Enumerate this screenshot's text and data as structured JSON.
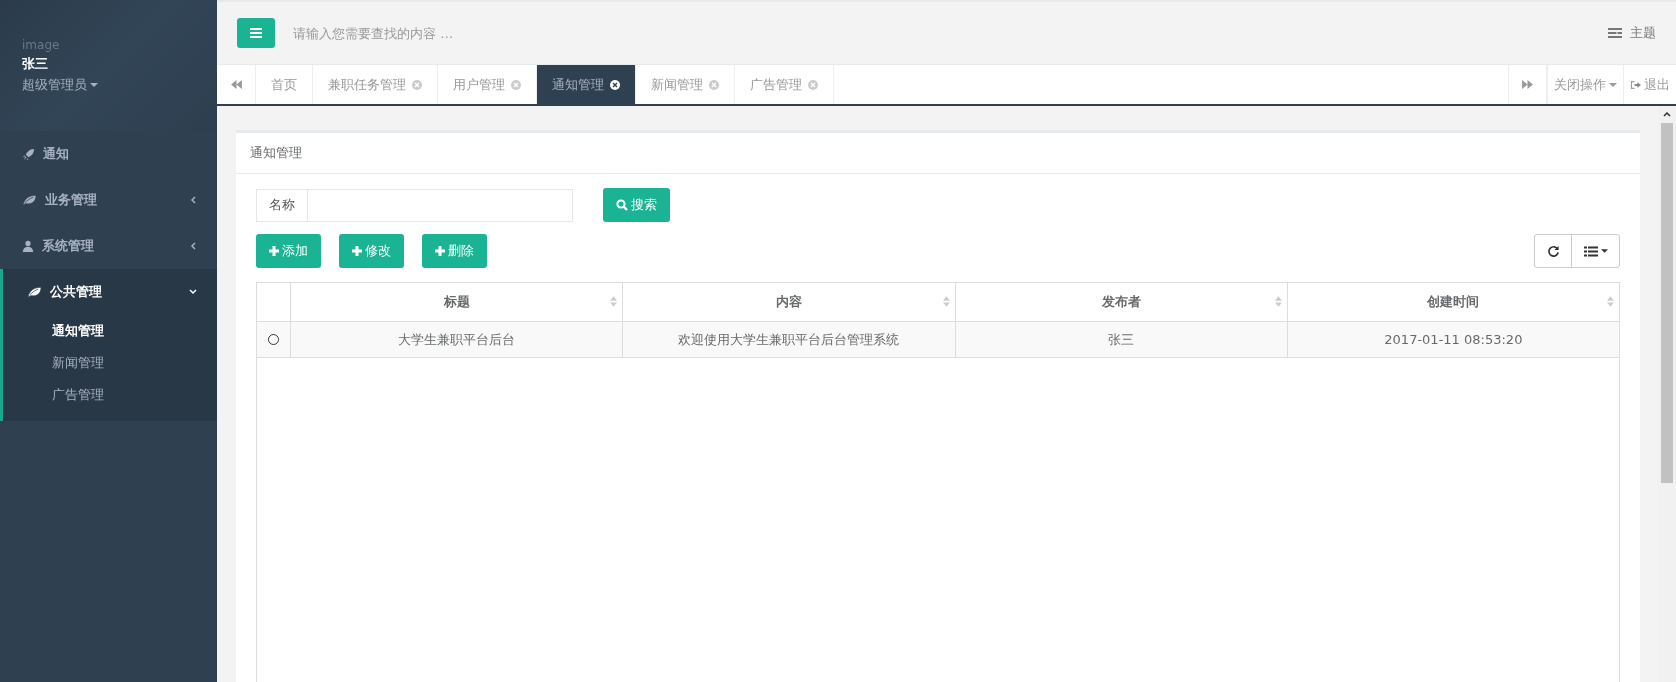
{
  "sidebar": {
    "profile": {
      "image_label": "image",
      "name": "张三",
      "role": "超级管理员"
    },
    "menu": [
      {
        "label": "通知",
        "has_children": false,
        "expanded": false
      },
      {
        "label": "业务管理",
        "has_children": true,
        "expanded": false
      },
      {
        "label": "系统管理",
        "has_children": true,
        "expanded": false
      },
      {
        "label": "公共管理",
        "has_children": true,
        "expanded": true,
        "children": [
          {
            "label": "通知管理",
            "selected": true
          },
          {
            "label": "新闻管理",
            "selected": false
          },
          {
            "label": "广告管理",
            "selected": false
          }
        ]
      }
    ]
  },
  "top_bar": {
    "search": {
      "placeholder": "请输入您需要查找的内容 …"
    },
    "theme": "主题"
  },
  "tabs": [
    {
      "label": "首页",
      "selected": false,
      "closable": false
    },
    {
      "label": "兼职任务管理",
      "selected": false,
      "closable": true
    },
    {
      "label": "用户管理",
      "selected": false,
      "closable": true
    },
    {
      "label": "通知管理",
      "selected": true,
      "closable": true
    },
    {
      "label": "新闻管理",
      "selected": false,
      "closable": true
    },
    {
      "label": "广告管理",
      "selected": false,
      "closable": true
    }
  ],
  "tab_actions": {
    "close_menu": "关闭操作",
    "logout": "退出"
  },
  "panel": {
    "title": "通知管理",
    "filter": {
      "label": "名称",
      "button": "搜索"
    },
    "buttons": [
      "添加",
      "修改",
      "删除"
    ],
    "table": {
      "columns": [
        "标题",
        "内容",
        "发布者",
        "创建时间"
      ],
      "rows": [
        {
          "selected": false,
          "cells": [
            "大学生兼职平台后台",
            "欢迎使用大学生兼职平台后台管理系统",
            "张三",
            "2017-01-11 08:53:20"
          ]
        }
      ]
    }
  }
}
